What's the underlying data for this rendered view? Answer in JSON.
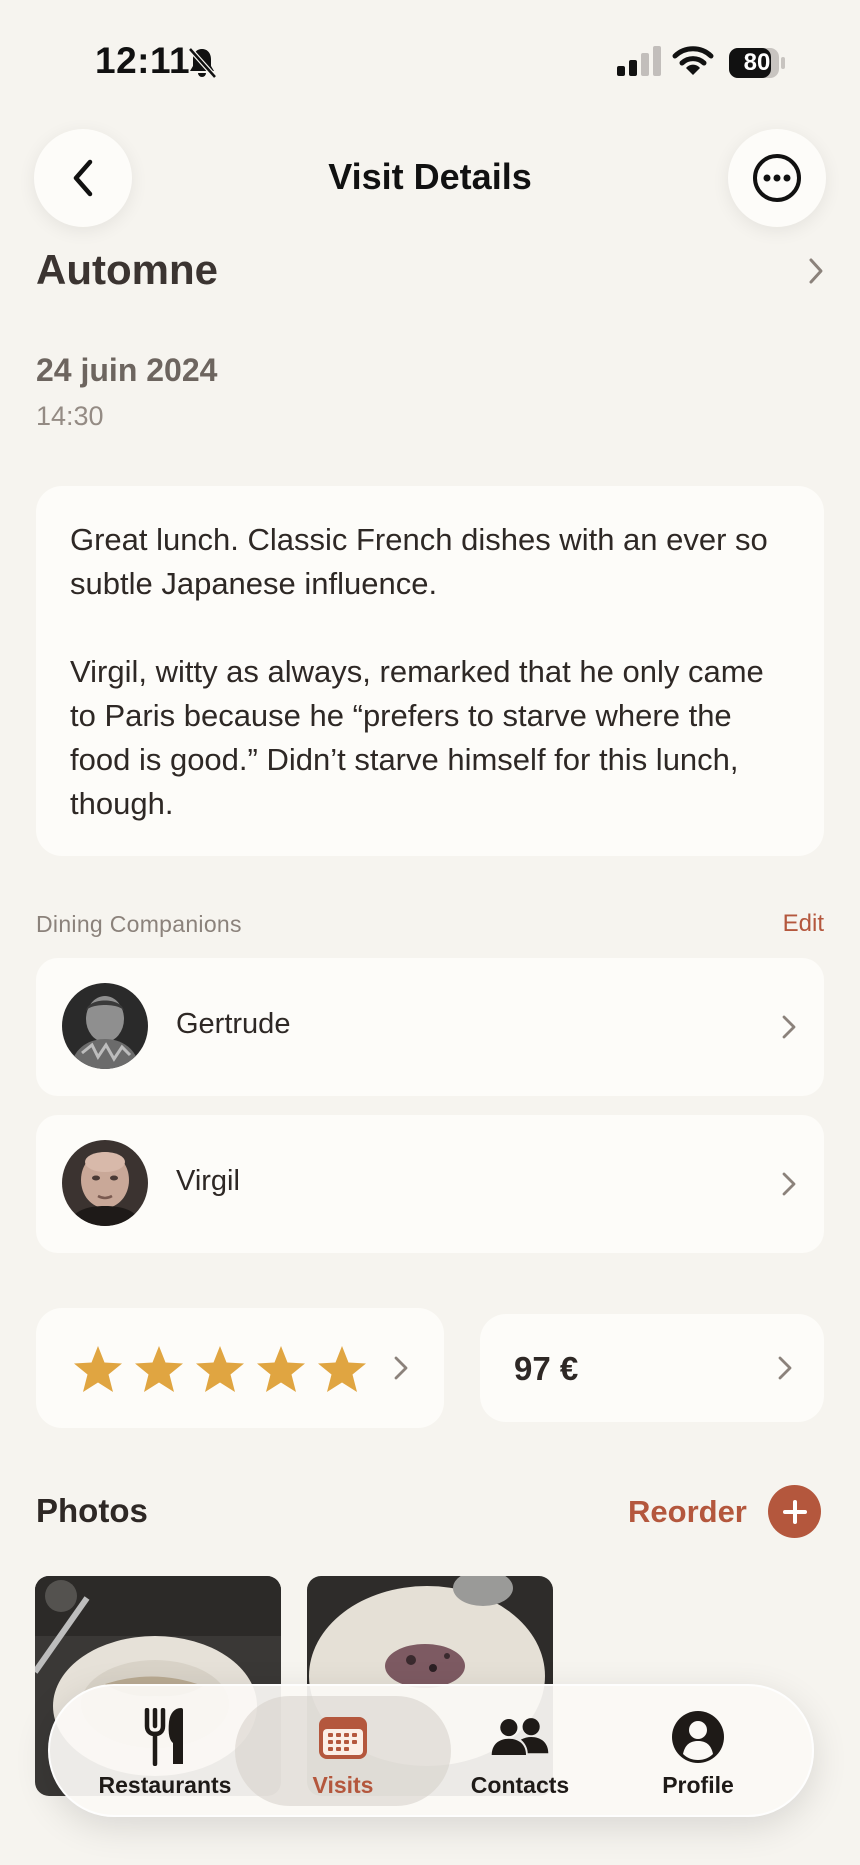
{
  "status_bar": {
    "time": "12:11",
    "battery": "80"
  },
  "header": {
    "title": "Visit Details"
  },
  "restaurant": {
    "name": "Automne"
  },
  "visit": {
    "date": "24 juin 2024",
    "time": "14:30"
  },
  "notes": {
    "paragraphs": [
      "Great lunch. Classic French dishes with an ever so subtle Japanese influence.",
      "Virgil, witty as always, remarked that he only came to Paris because he “prefers to starve where the food is good.” Didn’t starve himself for this lunch, though."
    ]
  },
  "companions": {
    "label": "Dining Companions",
    "edit_label": "Edit",
    "items": [
      {
        "name": "Gertrude"
      },
      {
        "name": "Virgil"
      }
    ]
  },
  "rating": {
    "stars": 5,
    "max": 5
  },
  "price": {
    "value": "97 €"
  },
  "photos": {
    "title": "Photos",
    "reorder_label": "Reorder"
  },
  "tab_bar": {
    "items": [
      {
        "label": "Restaurants",
        "icon": "fork-knife-icon"
      },
      {
        "label": "Visits",
        "icon": "calendar-icon"
      },
      {
        "label": "Contacts",
        "icon": "people-icon"
      },
      {
        "label": "Profile",
        "icon": "person-circle-icon"
      }
    ],
    "active": "Visits"
  },
  "colors": {
    "background": "#f6f4ef",
    "card": "#fdfcf9",
    "accent": "#b4573d",
    "star": "#e0a541"
  }
}
